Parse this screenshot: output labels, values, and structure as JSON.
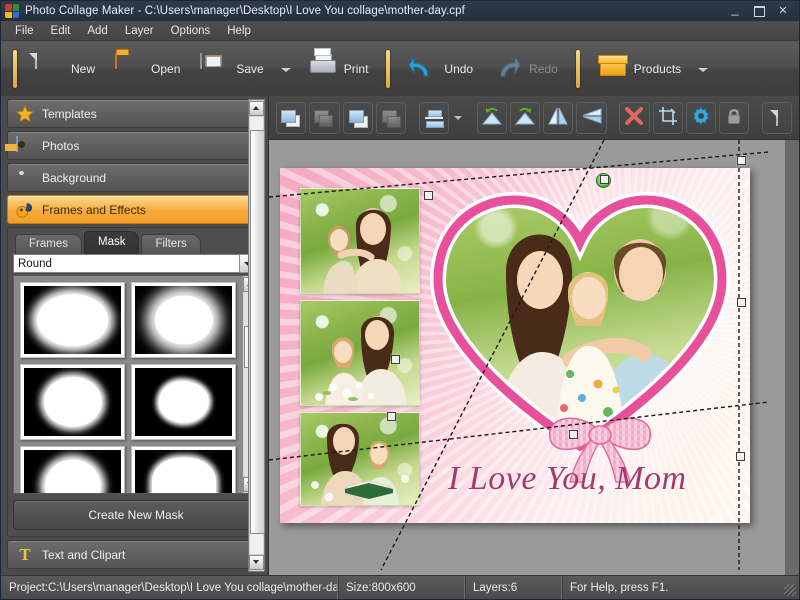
{
  "window": {
    "title": "Photo Collage Maker - C:\\Users\\manager\\Desktop\\I Love You collage\\mother-day.cpf",
    "app_icon": "app-logo-icon",
    "minimize": "_",
    "maximize": "□",
    "close": "✕"
  },
  "menu": [
    {
      "label": "File"
    },
    {
      "label": "Edit"
    },
    {
      "label": "Add"
    },
    {
      "label": "Layer"
    },
    {
      "label": "Options"
    },
    {
      "label": "Help"
    }
  ],
  "toolbar": {
    "buttons": [
      {
        "label": "New",
        "icon": "new-page-icon",
        "enabled": true,
        "dropdown": false
      },
      {
        "label": "Open",
        "icon": "open-folder-icon",
        "enabled": true,
        "dropdown": false
      },
      {
        "label": "Save",
        "icon": "save-floppy-icon",
        "enabled": true,
        "dropdown": true
      },
      {
        "label": "Print",
        "icon": "printer-icon",
        "enabled": true,
        "dropdown": false
      },
      {
        "label": "Undo",
        "icon": "undo-arrow-icon",
        "enabled": true,
        "dropdown": false
      },
      {
        "label": "Redo",
        "icon": "redo-arrow-icon",
        "enabled": false,
        "dropdown": false
      },
      {
        "label": "Products",
        "icon": "products-box-icon",
        "enabled": true,
        "dropdown": true
      }
    ]
  },
  "sidebar": {
    "sections": [
      {
        "label": "Templates",
        "icon": "star-icon",
        "active": false
      },
      {
        "label": "Photos",
        "icon": "photo-icon",
        "active": false
      },
      {
        "label": "Background",
        "icon": "background-drop-icon",
        "active": false
      },
      {
        "label": "Frames and Effects",
        "icon": "frames-effects-icon",
        "active": true
      },
      {
        "label": "Text and Clipart",
        "icon": "text-t-icon",
        "active": false
      }
    ],
    "tabs": [
      {
        "label": "Frames",
        "active": false
      },
      {
        "label": "Mask",
        "active": true
      },
      {
        "label": "Filters",
        "active": false
      }
    ],
    "mask_category": {
      "selected": "Round",
      "placeholder": "Round"
    },
    "mask_thumbnails": [
      {
        "name": "mask-round-ring",
        "shape": "m-round"
      },
      {
        "name": "mask-soft-oval",
        "shape": "m-soft"
      },
      {
        "name": "mask-oval-rough",
        "shape": "m-oval"
      },
      {
        "name": "mask-scalloped-blob",
        "shape": "m-blob"
      },
      {
        "name": "mask-egg-soft",
        "shape": "m-egg"
      },
      {
        "name": "mask-arch-texture",
        "shape": "m-arch"
      }
    ],
    "create_mask_button": "Create New Mask"
  },
  "canvas_toolbar": {
    "buttons": [
      {
        "name": "bring-to-front-button",
        "icon": "bring-to-front-icon"
      },
      {
        "name": "send-to-back-button",
        "icon": "send-to-back-icon"
      },
      {
        "name": "bring-forward-button",
        "icon": "bring-forward-icon"
      },
      {
        "name": "send-backward-button",
        "icon": "send-backward-icon"
      },
      {
        "name": "align-button",
        "icon": "align-icon",
        "dropdown": true
      },
      {
        "name": "rotate-left-button",
        "icon": "rotate-left-icon"
      },
      {
        "name": "rotate-right-button",
        "icon": "rotate-right-icon"
      },
      {
        "name": "flip-horizontal-button",
        "icon": "flip-horizontal-icon"
      },
      {
        "name": "flip-vertical-button",
        "icon": "flip-vertical-icon"
      },
      {
        "name": "delete-button",
        "icon": "delete-x-icon"
      },
      {
        "name": "crop-button",
        "icon": "crop-icon"
      },
      {
        "name": "settings-button",
        "icon": "gear-icon"
      },
      {
        "name": "lock-button",
        "icon": "lock-icon"
      },
      {
        "name": "page-button",
        "icon": "page-icon"
      }
    ]
  },
  "collage": {
    "caption": "I Love You, Mom",
    "caption_color": "#a33a6e",
    "accent_pink": "#e8509b",
    "background_label": "pink-rays-gradient",
    "photos": [
      {
        "name": "photo-mother-daughter-hug"
      },
      {
        "name": "photo-mother-daughter-flowers"
      },
      {
        "name": "photo-mother-daughter-book"
      }
    ],
    "heart_frame": {
      "name": "heart-frame-family-photo"
    },
    "bow": {
      "name": "pink-ribbon-bow"
    }
  },
  "statusbar": {
    "project": "Project:C:\\Users\\manager\\Desktop\\I Love You collage\\mother-da...",
    "size": "Size:800x600",
    "layers": "Layers:6",
    "help": "For Help, press F1."
  }
}
